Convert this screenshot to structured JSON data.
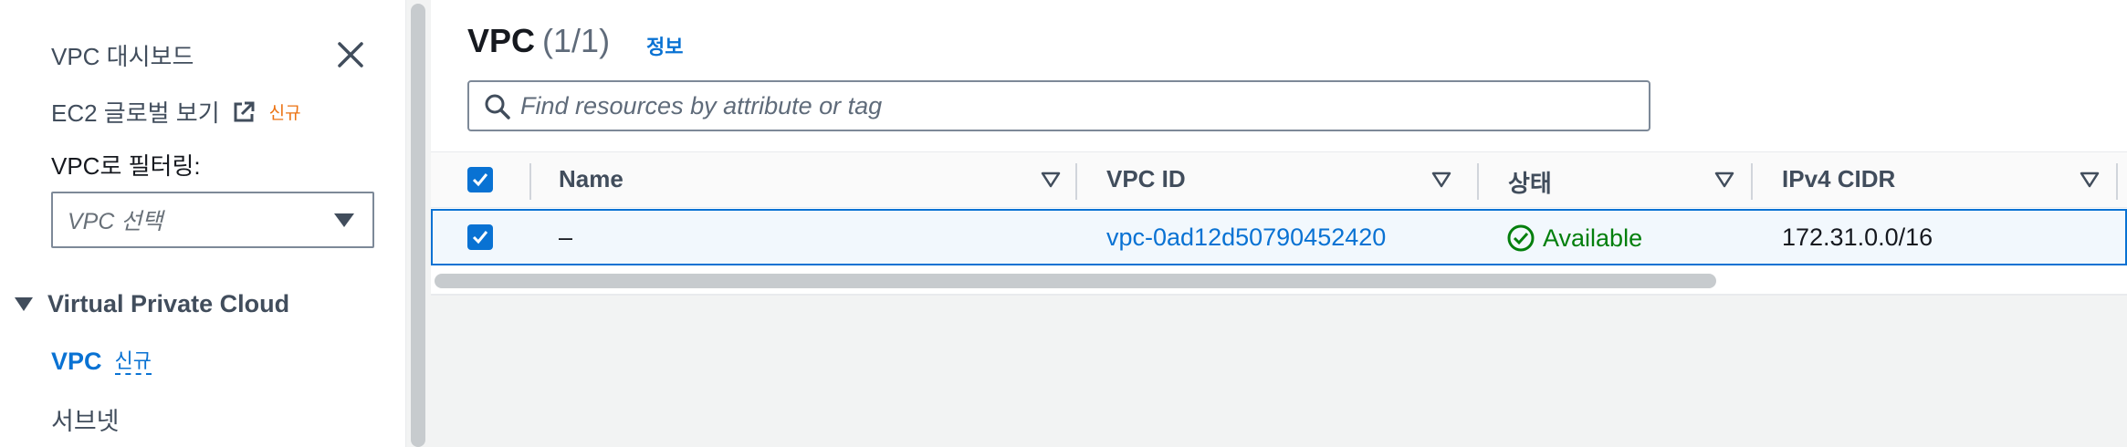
{
  "sidebar": {
    "dashboard_label": "VPC 대시보드",
    "ec2_global_view_label": "EC2 글로벌 보기",
    "ec2_new_badge": "신규",
    "filter_label": "VPC로 필터링:",
    "filter_placeholder": "VPC 선택",
    "section_title": "Virtual Private Cloud",
    "nav_items": [
      {
        "label": "VPC",
        "badge": "신규",
        "active": true
      },
      {
        "label": "서브넷",
        "active": false
      }
    ]
  },
  "main": {
    "title": "VPC",
    "count": "(1/1)",
    "info_link": "정보",
    "search_placeholder": "Find resources by attribute or tag",
    "columns": [
      "Name",
      "VPC ID",
      "상태",
      "IPv4 CIDR"
    ],
    "rows": [
      {
        "selected": true,
        "name": "–",
        "vpc_id": "vpc-0ad12d50790452420",
        "status": "Available",
        "ipv4_cidr": "172.31.0.0/16"
      }
    ]
  },
  "colors": {
    "accent": "#0972d3",
    "status_available": "#037f0c",
    "new_badge": "#ec7211"
  },
  "icons": [
    "close-icon",
    "external-link-icon",
    "chevron-down-icon",
    "caret-down-icon",
    "search-icon",
    "sort-icon",
    "check-icon",
    "status-ok-icon"
  ]
}
